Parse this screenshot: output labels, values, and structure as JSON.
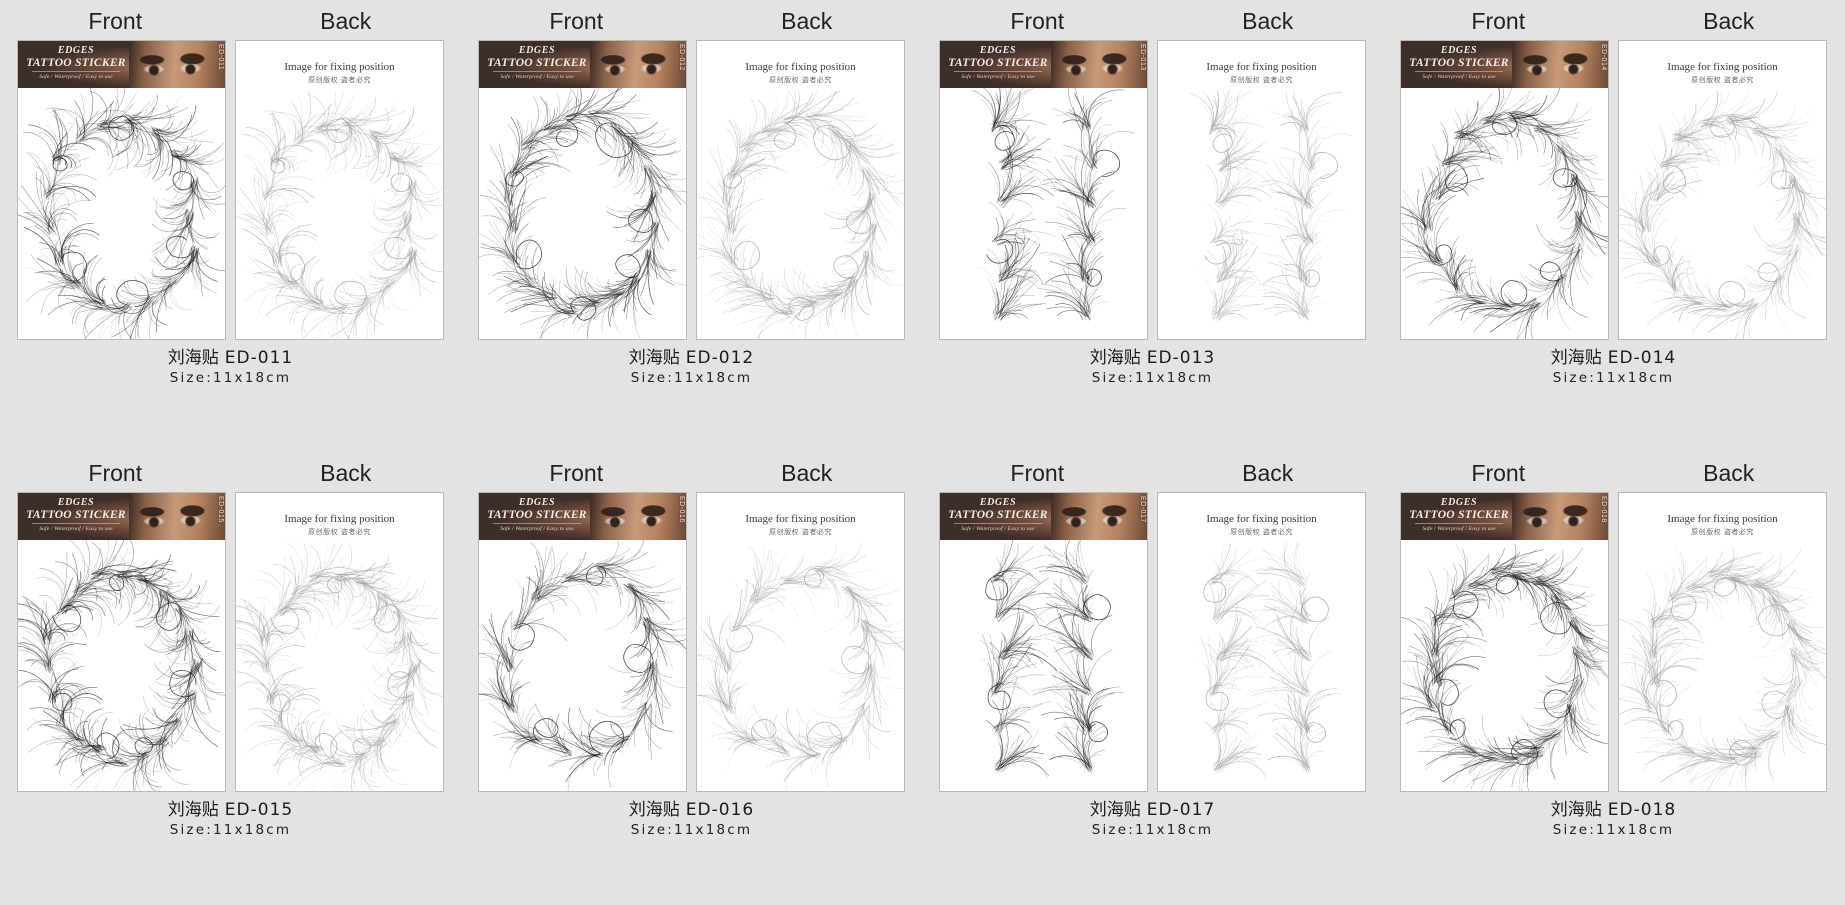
{
  "page": {
    "background_color": "#e3e3e3",
    "columns": 4,
    "rows": 2
  },
  "panel_labels": {
    "front": "Front",
    "back": "Back"
  },
  "front_banner": {
    "line1": "EDGES",
    "line2": "TATTOO STICKER",
    "line3": "Safe / Waterproof / Easy to use",
    "banner_color": "#4a3833",
    "text_color": "#f3ece8"
  },
  "back_panel": {
    "title": "Image for fixing position",
    "subtitle": "原创版权 盗者必究"
  },
  "caption": {
    "product_name": "刘海贴",
    "size_label": "Size:11x18cm"
  },
  "products": [
    {
      "code": "ED-011",
      "name": "刘海贴",
      "size": "Size:11x18cm",
      "style": "wispy-oval-curl"
    },
    {
      "code": "ED-012",
      "name": "刘海贴",
      "size": "Size:11x18cm",
      "style": "swirl-baby-hair"
    },
    {
      "code": "ED-013",
      "name": "刘海贴",
      "size": "Size:11x18cm",
      "style": "wavy-edge-frame"
    },
    {
      "code": "ED-014",
      "name": "刘海贴",
      "size": "Size:11x18cm",
      "style": "feather-tuft-pairs"
    },
    {
      "code": "ED-015",
      "name": "刘海贴",
      "size": "Size:11x18cm",
      "style": "curly-side-sweep"
    },
    {
      "code": "ED-016",
      "name": "刘海贴",
      "size": "Size:11x18cm",
      "style": "loop-curl-edges"
    },
    {
      "code": "ED-017",
      "name": "刘海贴",
      "size": "Size:11x18cm",
      "style": "soft-wisp-cluster"
    },
    {
      "code": "ED-018",
      "name": "刘海贴",
      "size": "Size:11x18cm",
      "style": "symmetric-tuft-grid"
    }
  ]
}
